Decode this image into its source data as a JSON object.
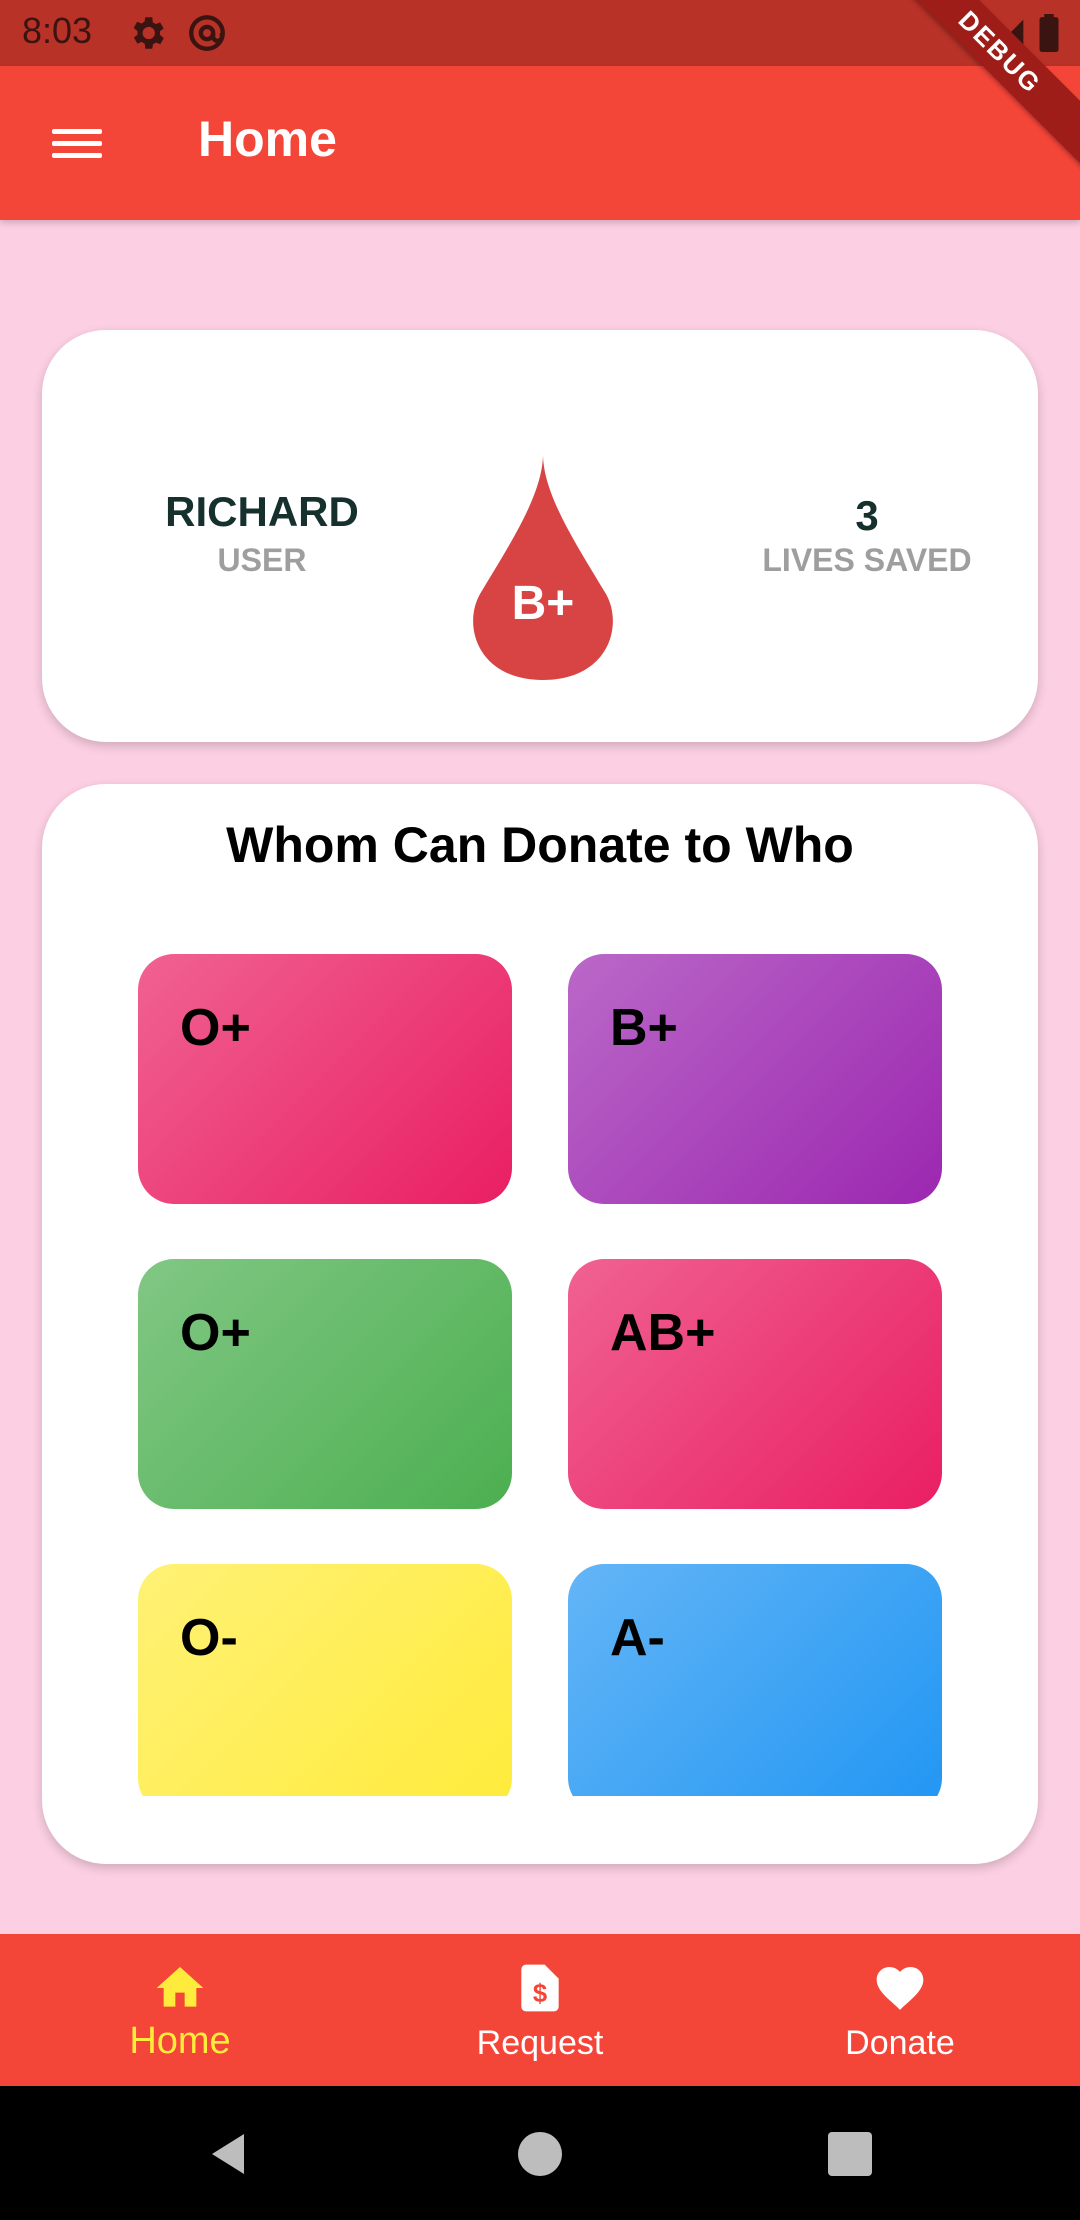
{
  "status_bar": {
    "time": "8:03"
  },
  "app_bar": {
    "title": "Home",
    "debug_banner": "DEBUG"
  },
  "profile": {
    "name": "RICHARD",
    "role": "USER",
    "blood_type": "B+",
    "lives_saved_count": "3",
    "lives_saved_label": "LIVES SAVED"
  },
  "donate_section": {
    "title": "Whom Can Donate to Who",
    "tiles": [
      {
        "label": "O+",
        "color": "#E91E63"
      },
      {
        "label": "B+",
        "color": "#9C27B0"
      },
      {
        "label": "O+",
        "color": "#4CAF50"
      },
      {
        "label": "AB+",
        "color": "#E91E63"
      },
      {
        "label": "O-",
        "color": "#FFEB3B"
      },
      {
        "label": "A-",
        "color": "#2196F3"
      }
    ]
  },
  "bottom_nav": {
    "items": [
      {
        "label": "Home",
        "icon": "home-icon",
        "active": true
      },
      {
        "label": "Request",
        "icon": "request-receipt-icon",
        "active": false
      },
      {
        "label": "Donate",
        "icon": "heart-icon",
        "active": false
      }
    ]
  },
  "colors": {
    "primary": "#F44539",
    "status_bar": "#B93227",
    "background": "#FCCFE3",
    "active_nav": "#FFEB3B",
    "blood_drop": "#D84343"
  }
}
